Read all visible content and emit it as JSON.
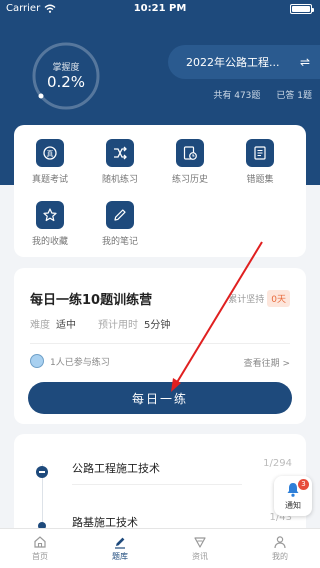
{
  "status_bar": {
    "carrier": "Carrier",
    "time": "10:21 PM"
  },
  "mastery": {
    "label": "掌握度",
    "value": "0.2%",
    "fraction": 0.002
  },
  "exam": {
    "name": "2022年公路工程...",
    "swap_icon": "swap-icon"
  },
  "stats": {
    "total": "共有 473题",
    "answered": "已答 1题"
  },
  "tools": [
    {
      "label": "真题考试",
      "icon": "exam-icon"
    },
    {
      "label": "随机练习",
      "icon": "shuffle-icon"
    },
    {
      "label": "练习历史",
      "icon": "history-icon"
    },
    {
      "label": "错题集",
      "icon": "wrong-book-icon"
    },
    {
      "label": "我的收藏",
      "icon": "star-icon"
    },
    {
      "label": "我的笔记",
      "icon": "pencil-icon"
    }
  ],
  "daily": {
    "title": "每日一练10题训练营",
    "streak_label": "累计坚持",
    "streak_days": "0天",
    "difficulty_label": "难度",
    "difficulty_value": "适中",
    "time_label": "预计用时",
    "time_value": "5分钟",
    "participants": "1人已参与练习",
    "history_link": "查看往期 >",
    "button": "每日一练"
  },
  "chapters": [
    {
      "name": "公路工程施工技术",
      "count": "1/294"
    },
    {
      "name": "路基施工技术",
      "count": "1/43"
    }
  ],
  "notify": {
    "label": "通知",
    "badge": "3"
  },
  "tabs": [
    {
      "label": "首页",
      "icon": "home-icon"
    },
    {
      "label": "题库",
      "icon": "question-bank-icon"
    },
    {
      "label": "资讯",
      "icon": "news-icon"
    },
    {
      "label": "我的",
      "icon": "profile-icon"
    }
  ],
  "colors": {
    "primary": "#1e4a7c",
    "accent": "#e86a3c",
    "annotation": "#e02020"
  }
}
